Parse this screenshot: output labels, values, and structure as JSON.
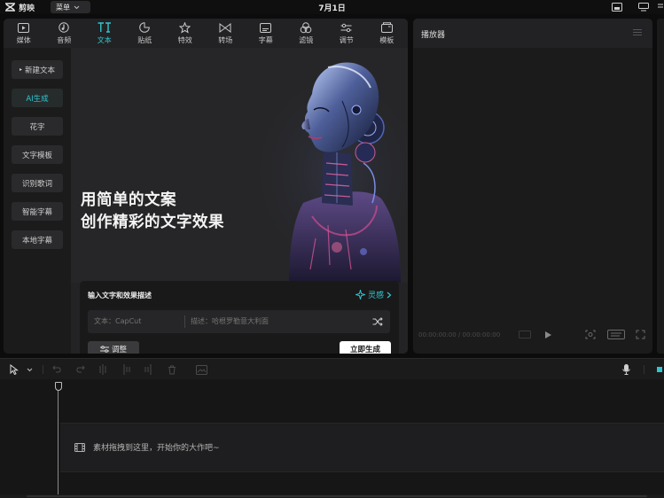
{
  "app": {
    "name": "剪映",
    "menu_label": "菜单",
    "project_title": "7月1日"
  },
  "toolbar": {
    "tabs": [
      {
        "label": "媒体",
        "icon": "media-icon"
      },
      {
        "label": "音频",
        "icon": "audio-icon"
      },
      {
        "label": "文本",
        "icon": "text-icon",
        "active": true
      },
      {
        "label": "贴纸",
        "icon": "sticker-icon"
      },
      {
        "label": "特效",
        "icon": "effects-icon"
      },
      {
        "label": "转场",
        "icon": "transition-icon"
      },
      {
        "label": "字幕",
        "icon": "subtitle-icon"
      },
      {
        "label": "滤镜",
        "icon": "filter-icon"
      },
      {
        "label": "调节",
        "icon": "adjust-icon"
      },
      {
        "label": "模板",
        "icon": "template-icon"
      }
    ]
  },
  "sidebar": {
    "items": [
      {
        "label": "新建文本",
        "has_caret": true
      },
      {
        "label": "AI生成",
        "active": true
      },
      {
        "label": "花字"
      },
      {
        "label": "文字模板"
      },
      {
        "label": "识别歌词"
      },
      {
        "label": "智能字幕"
      },
      {
        "label": "本地字幕"
      }
    ]
  },
  "banner": {
    "line1": "用简单的文案",
    "line2": "创作精彩的文字效果"
  },
  "generator": {
    "title": "输入文字和效果描述",
    "inspire_label": "灵感",
    "text_placeholder": "文本：CapCut",
    "desc_placeholder": "描述：哈根罗勒意大利面",
    "adjust_label": "调整",
    "generate_label": "立即生成"
  },
  "player": {
    "title": "播放器",
    "timecode": "00:00:00:00 / 00:00:00:00"
  },
  "timeline": {
    "drop_hint": "素材拖拽到这里，开始你的大作吧~"
  },
  "colors": {
    "accent": "#2fc6d0",
    "panel": "#1b1b1c",
    "background": "#0c0c0d"
  }
}
